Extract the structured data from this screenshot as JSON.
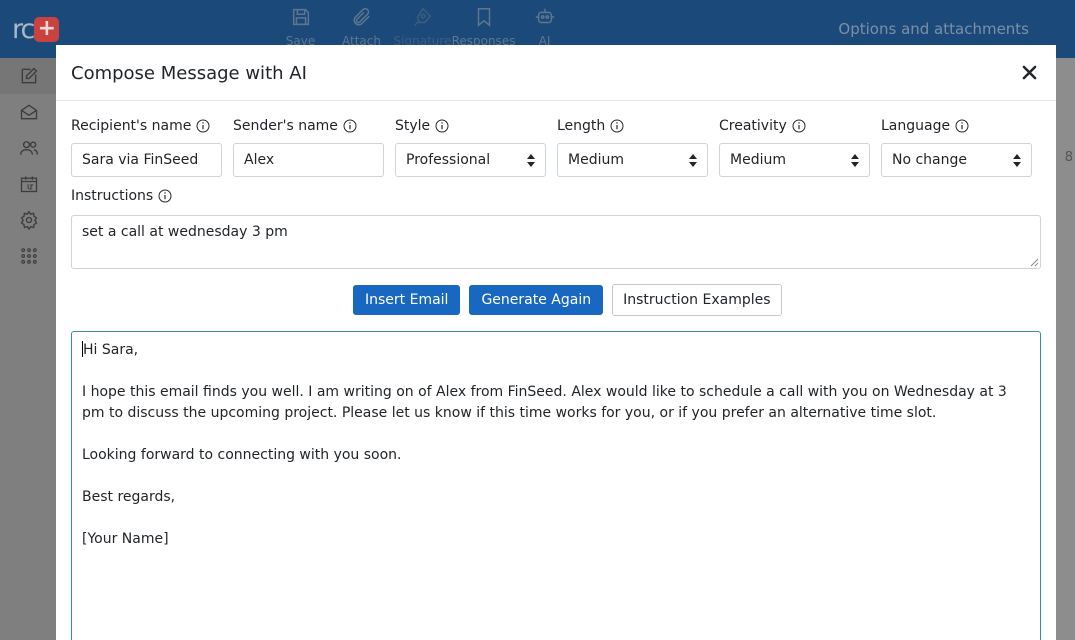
{
  "app": {
    "logo_text": "rc",
    "logo_plus": "+",
    "toolbar": [
      {
        "label": "Save",
        "icon": "save-icon"
      },
      {
        "label": "Attach",
        "icon": "paperclip-icon"
      },
      {
        "label": "Signature",
        "icon": "signature-pen-icon"
      },
      {
        "label": "Responses",
        "icon": "bookmark-icon"
      },
      {
        "label": "AI",
        "icon": "robot-icon"
      }
    ],
    "options_link": "Options and attachments",
    "bg_digit": "8"
  },
  "modal": {
    "title": "Compose Message with AI",
    "fields": {
      "recipient": {
        "label": "Recipient's name",
        "value": "Sara via FinSeed"
      },
      "sender": {
        "label": "Sender's name",
        "value": "Alex"
      },
      "style": {
        "label": "Style",
        "value": "Professional"
      },
      "length": {
        "label": "Length",
        "value": "Medium"
      },
      "creativity": {
        "label": "Creativity",
        "value": "Medium"
      },
      "language": {
        "label": "Language",
        "value": "No change"
      }
    },
    "instructions": {
      "label": "Instructions",
      "value": "set a call at wednesday 3 pm"
    },
    "buttons": {
      "insert": "Insert Email",
      "generate": "Generate Again",
      "examples": "Instruction Examples"
    },
    "email": {
      "greeting": "Hi Sara,",
      "para1": "I hope this email finds you well. I am writing on of Alex from FinSeed. Alex would like to schedule a call with you on Wednesday at 3 pm to discuss the upcoming project. Please let us know if this time works for you, or if you prefer an alternative time slot.",
      "para2": "Looking forward to connecting with you soon.",
      "signoff": "Best regards,",
      "name": "[Your Name]"
    }
  },
  "colors": {
    "topbar": "#1b4a7a",
    "primary_button": "#1867c0",
    "email_border": "#3a8f89",
    "logo_plus": "#c9423f"
  }
}
